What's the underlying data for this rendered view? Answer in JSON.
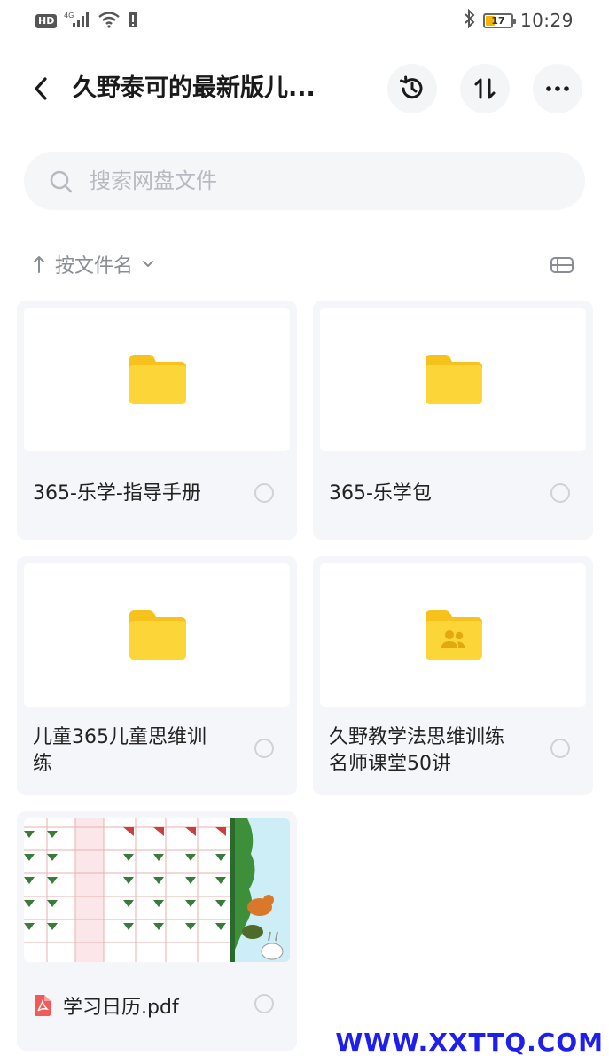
{
  "status_bar": {
    "left_badges": [
      "HD",
      "4G"
    ],
    "time": "10:29",
    "battery_level": "17",
    "battery_color": "#f5b400"
  },
  "header": {
    "title": "久野泰可的最新版儿...",
    "buttons": [
      "history-icon",
      "transfer-icon",
      "more-icon"
    ]
  },
  "search": {
    "placeholder": "搜索网盘文件"
  },
  "sort": {
    "label": "按文件名",
    "icon": "arrow-up-icon",
    "view_icon": "list-view-icon"
  },
  "items": [
    {
      "name": "365-乐学-指导手册",
      "type": "folder",
      "icon": "folder-icon"
    },
    {
      "name": "365-乐学包",
      "type": "folder",
      "icon": "folder-icon"
    },
    {
      "name_lines": [
        "儿童365儿童思维训",
        "练"
      ],
      "type": "folder",
      "icon": "folder-icon"
    },
    {
      "name_lines": [
        "久野教学法思维训练",
        "名师课堂50讲"
      ],
      "type": "shared-folder",
      "icon": "shared-folder-icon"
    },
    {
      "name": "学习日历.pdf",
      "type": "pdf",
      "icon": "pdf-icon"
    }
  ],
  "colors": {
    "folder": "#fcd538",
    "folder_tab": "#f7c21c",
    "pdf": "#f05a5a",
    "card_bg": "#f5f6f9"
  },
  "watermark": "WWW.XXTTQ.COM"
}
